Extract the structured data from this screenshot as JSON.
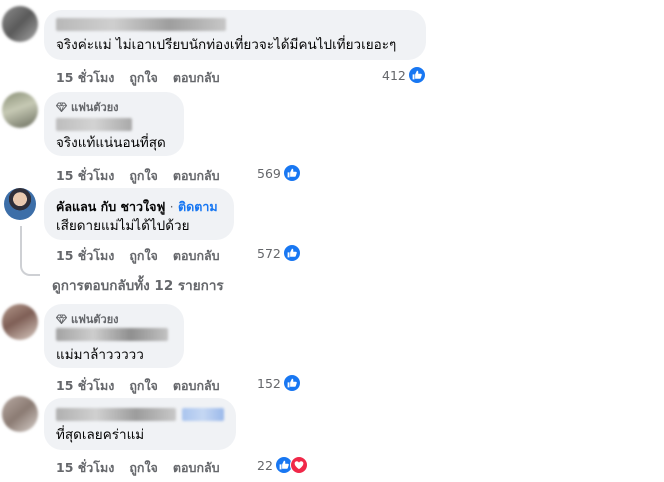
{
  "comments": [
    {
      "text": "จริงค่ะแม่ ไม่เอาเปรียบนักท่องเที่ยวจะได้มีคนไปเที่ยวเยอะๆ",
      "time": "15 ชั่วโมง",
      "like": "ถูกใจ",
      "reply": "ตอบกลับ",
      "reactions": "412"
    },
    {
      "badge": "แฟนตัวยง",
      "text": "จริงแท้แน่นอนที่สุด",
      "time": "15 ชั่วโมง",
      "like": "ถูกใจ",
      "reply": "ตอบกลับ",
      "reactions": "569"
    },
    {
      "author": "คัลแลน กับ ชาวใจฟู",
      "dot": "·",
      "follow": "ติดตาม",
      "text": "เสียดายแม่ไม่ได้ไปด้วย",
      "time": "15 ชั่วโมง",
      "like": "ถูกใจ",
      "reply": "ตอบกลับ",
      "reactions": "572"
    },
    {
      "badge": "แฟนตัวยง",
      "text": "แม่มาล้าววววว",
      "time": "15 ชั่วโมง",
      "like": "ถูกใจ",
      "reply": "ตอบกลับ",
      "reactions": "152"
    },
    {
      "text": "ที่สุดเลยคร่าแม่",
      "time": "15 ชั่วโมง",
      "like": "ถูกใจ",
      "reply": "ตอบกลับ",
      "reactions": "22"
    }
  ],
  "view_replies": "ดูการตอบกลับทั้ง 12 รายการ",
  "icons": {
    "like": "thumbs-up-icon",
    "love": "heart-icon",
    "badge": "diamond-icon"
  },
  "colors": {
    "bubble": "#f0f2f5",
    "link": "#1877f2",
    "love": "#f02849",
    "meta": "#65676b"
  }
}
